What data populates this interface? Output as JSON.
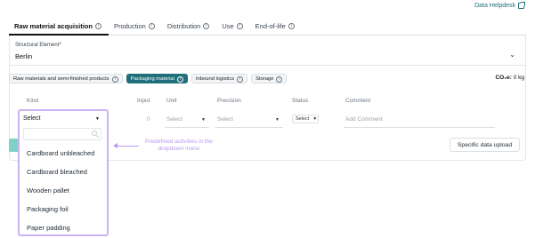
{
  "header": {
    "helpdesk_label": "Data Helpdesk"
  },
  "tabs": [
    {
      "label": "Raw material acquisition",
      "active": true
    },
    {
      "label": "Production",
      "active": false
    },
    {
      "label": "Distribution",
      "active": false
    },
    {
      "label": "Use",
      "active": false
    },
    {
      "label": "End-of-life",
      "active": false
    }
  ],
  "structural_element": {
    "label": "Structural Element*",
    "value": "Berlin"
  },
  "chips": [
    {
      "label": "Raw materials and semi-finished products",
      "active": false
    },
    {
      "label": "Packaging material",
      "active": true
    },
    {
      "label": "Inbound logistics",
      "active": false
    },
    {
      "label": "Storage",
      "active": false
    }
  ],
  "co2": {
    "label": "CO₂e:",
    "value": "0 kg"
  },
  "table": {
    "headers": {
      "kind": "Kind",
      "input": "Input",
      "unit": "Unit",
      "precision": "Precision",
      "status": "Status",
      "comment": "Comment"
    },
    "row": {
      "input": "0",
      "unit": "Select",
      "precision": "Select",
      "status": "Select",
      "comment": "Add Comment"
    }
  },
  "dropdown": {
    "selected": "Select",
    "items": [
      "Cardboard unbleached",
      "Cardboard bleached",
      "Wooden pallet",
      "Packaging foil",
      "Paper padding"
    ]
  },
  "annotation": "Predefined activities in the dropdown menu",
  "upload_button": "Specific data upload",
  "colors": {
    "accent": "#1f6e7a",
    "annotation": "#b79af0",
    "frame": "#c9b3f5"
  }
}
